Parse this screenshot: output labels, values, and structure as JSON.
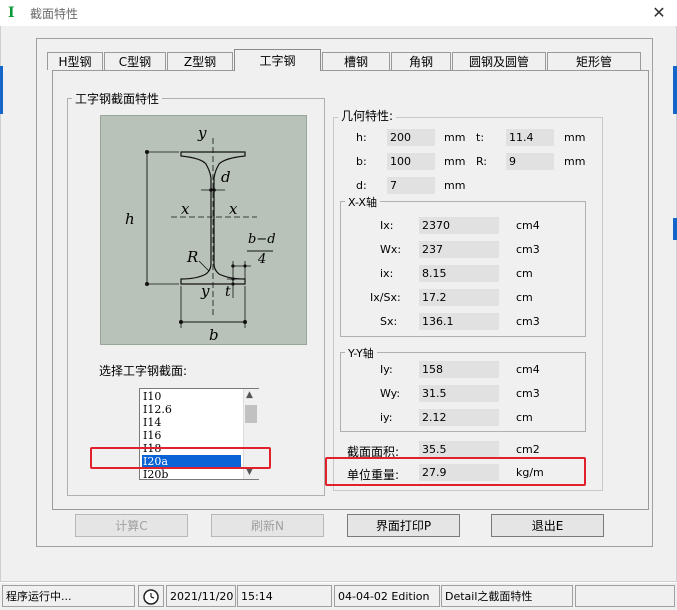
{
  "window": {
    "title": "截面特性",
    "icon": "I",
    "close": "✕"
  },
  "tabs": [
    "H型钢",
    "C型钢",
    "Z型钢",
    "工字钢",
    "槽钢",
    "角钢",
    "圆钢及圆管",
    "矩形管"
  ],
  "section_group": {
    "title": "工字钢截面特性"
  },
  "diagram": {
    "y_top": "y",
    "y_bottom": "y",
    "x_left": "x",
    "x_right": "x",
    "d": "d",
    "h": "h",
    "R": "R",
    "t": "t",
    "b": "b",
    "frac_num": "b−d",
    "frac_den": "4"
  },
  "select_label": "选择工字钢截面:",
  "list_items": [
    "I10",
    "I12.6",
    "I14",
    "I16",
    "I18",
    "I20a",
    "I20b"
  ],
  "selected_index": 5,
  "geom": {
    "title": "几何特性:",
    "h_label": "h:",
    "h_value": "200",
    "h_unit": "mm",
    "t_label": "t:",
    "t_value": "11.4",
    "t_unit": "mm",
    "b_label": "b:",
    "b_value": "100",
    "b_unit": "mm",
    "R_label": "R:",
    "R_value": "9",
    "R_unit": "mm",
    "d_label": "d:",
    "d_value": "7",
    "d_unit": "mm"
  },
  "xx": {
    "title": "X-X轴",
    "rows": [
      {
        "label": "Ix:",
        "value": "2370",
        "unit": "cm4"
      },
      {
        "label": "Wx:",
        "value": "237",
        "unit": "cm3"
      },
      {
        "label": "ix:",
        "value": "8.15",
        "unit": "cm"
      },
      {
        "label": "Ix/Sx:",
        "value": "17.2",
        "unit": "cm"
      },
      {
        "label": "Sx:",
        "value": "136.1",
        "unit": "cm3"
      }
    ]
  },
  "yy": {
    "title": "Y-Y轴",
    "rows": [
      {
        "label": "Iy:",
        "value": "158",
        "unit": "cm4"
      },
      {
        "label": "Wy:",
        "value": "31.5",
        "unit": "cm3"
      },
      {
        "label": "iy:",
        "value": "2.12",
        "unit": "cm"
      }
    ]
  },
  "area": {
    "label": "截面面积:",
    "value": "35.5",
    "unit": "cm2"
  },
  "weight": {
    "label": "单位重量:",
    "value": "27.9",
    "unit": "kg/m"
  },
  "buttons": {
    "calc": "计算C",
    "refresh": "刷新N",
    "print": "界面打印P",
    "exit": "退出E"
  },
  "status": {
    "running": "程序运行中...",
    "date": "2021/11/20",
    "time": "15:14",
    "edition": "04-04-02 Edition",
    "detail": "Detail之截面特性"
  },
  "colors": {
    "selection": "#0a64d6",
    "highlight": "#e0202a",
    "diagram_bg": "#b8c2b8"
  }
}
